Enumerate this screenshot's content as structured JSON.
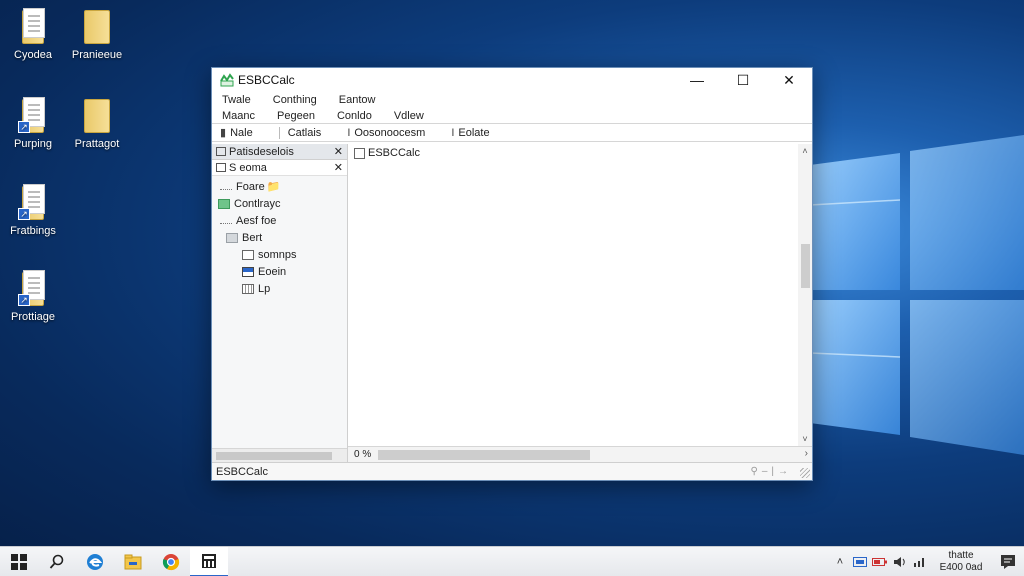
{
  "desktop": {
    "icons": [
      {
        "label": "Cyodea",
        "kind": "doc"
      },
      {
        "label": "Pranieeue",
        "kind": "folder"
      },
      {
        "label": "Purping",
        "kind": "doc-shortcut"
      },
      {
        "label": "Prattagot",
        "kind": "folder"
      },
      {
        "label": "Fratbings",
        "kind": "doc-shortcut"
      },
      {
        "label": "Prottiage",
        "kind": "doc-shortcut"
      }
    ]
  },
  "window": {
    "title": "ESBCCalc",
    "controls": {
      "minimize": "—",
      "maximize": "☐",
      "close": "✕"
    },
    "menu_row1": [
      "Twale",
      "Conthing",
      "Eantow"
    ],
    "menu_row2": [
      "Maanc",
      "Pegeen",
      "Conldo",
      "Vdlew"
    ],
    "toolbar": [
      "Nale",
      "Catlais",
      "Oosonoocesm",
      "Eolate"
    ],
    "left_pane": {
      "header": "Patisdeselois",
      "row": "S eoma",
      "tree": [
        {
          "label": "Foare",
          "icon": "dotted-line",
          "indent": 0
        },
        {
          "label": "Contlrayc",
          "icon": "green-folder",
          "indent": 0
        },
        {
          "label": "Aesf foe",
          "icon": "dotted-line",
          "indent": 0
        },
        {
          "label": "Bert",
          "icon": "grey-folder",
          "indent": 1
        },
        {
          "label": "somnps",
          "icon": "doc",
          "indent": 2
        },
        {
          "label": "Eoein",
          "icon": "blue-doc",
          "indent": 2
        },
        {
          "label": "Lp",
          "icon": "grid-doc",
          "indent": 2
        }
      ]
    },
    "document_tab": "ESBCCalc",
    "hscroll_pos": "0 %",
    "statusbar": "ESBCCalc"
  },
  "taskbar": {
    "clock_line1": "thatte",
    "clock_line2": "E400 0ad"
  },
  "colors": {
    "accent": "#2a66c9",
    "window_border": "#6c8fb8"
  }
}
